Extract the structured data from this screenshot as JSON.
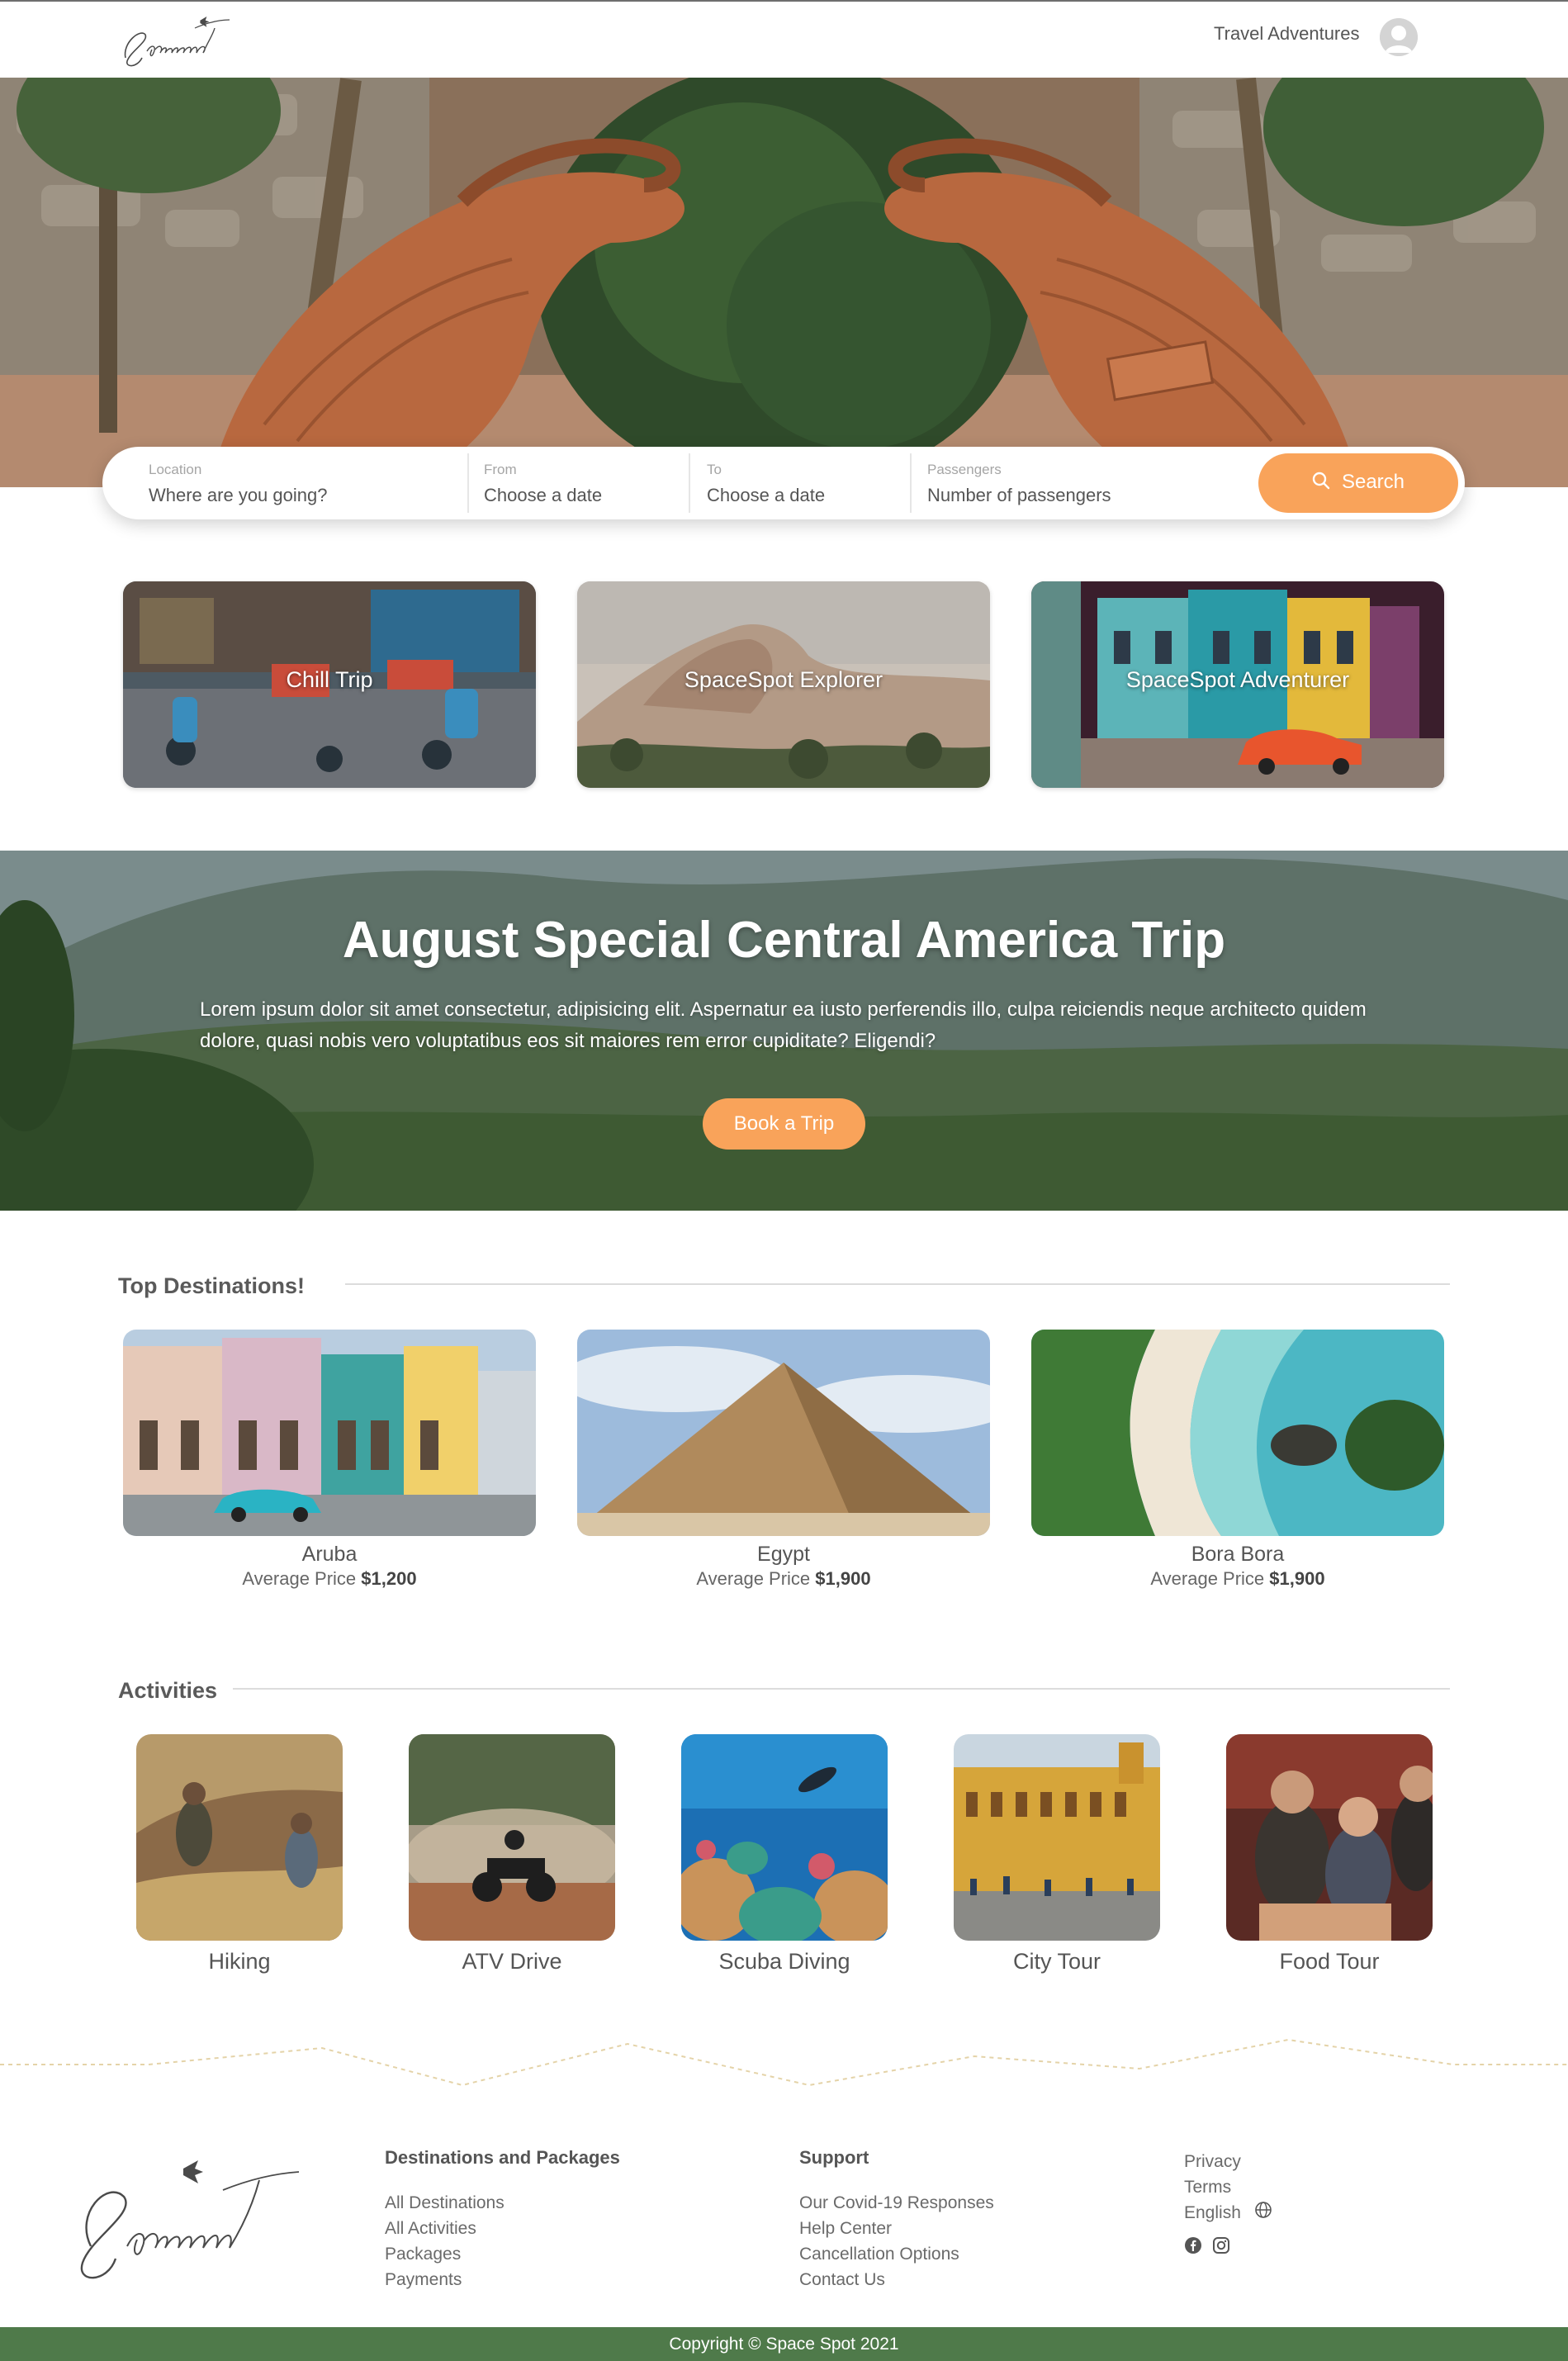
{
  "header": {
    "nav_link": "Travel Adventures",
    "logo_text": "Spacespot"
  },
  "search": {
    "location_label": "Location",
    "location_placeholder": "Where are you going?",
    "from_label": "From",
    "from_placeholder": "Choose a date",
    "to_label": "To",
    "to_placeholder": "Choose a date",
    "passengers_label": "Passengers",
    "passengers_placeholder": "Number of passengers",
    "button_label": "Search",
    "button_icon": "search-icon"
  },
  "trips": [
    {
      "label": "Chill Trip"
    },
    {
      "label": "SpaceSpot Explorer"
    },
    {
      "label": "SpaceSpot Adventurer"
    }
  ],
  "special": {
    "title": "August Special Central America Trip",
    "text": "Lorem ipsum dolor sit amet consectetur, adipisicing elit. Aspernatur ea iusto perferendis illo, culpa reiciendis neque architecto quidem dolore, quasi nobis vero voluptatibus eos sit maiores rem error cupiditate? Eligendi?",
    "button_label": "Book a Trip"
  },
  "destinations": {
    "title": "Top Destinations!",
    "price_prefix": "Average Price",
    "items": [
      {
        "name": "Aruba",
        "price": "$1,200"
      },
      {
        "name": "Egypt",
        "price": "$1,900"
      },
      {
        "name": "Bora Bora",
        "price": "$1,900"
      }
    ]
  },
  "activities": {
    "title": "Activities",
    "items": [
      {
        "name": "Hiking"
      },
      {
        "name": "ATV Drive"
      },
      {
        "name": "Scuba Diving"
      },
      {
        "name": "City Tour"
      },
      {
        "name": "Food Tour"
      }
    ]
  },
  "footer": {
    "logo_text": "Spacespot",
    "col1": {
      "title": "Destinations and Packages",
      "links": [
        "All Destinations",
        "All Activities",
        "Packages",
        "Payments"
      ]
    },
    "col2": {
      "title": "Support",
      "links": [
        "Our Covid-19 Responses",
        "Help Center",
        "Cancellation Options",
        "Contact Us"
      ]
    },
    "col3": {
      "links": [
        "Privacy",
        "Terms"
      ],
      "language": "English",
      "social_icons": [
        "facebook-icon",
        "instagram-icon"
      ]
    },
    "copyright": "Copyright © Space Spot 2021"
  },
  "colors": {
    "accent": "#f9a35a",
    "footer_bar": "#4f7a4a"
  }
}
